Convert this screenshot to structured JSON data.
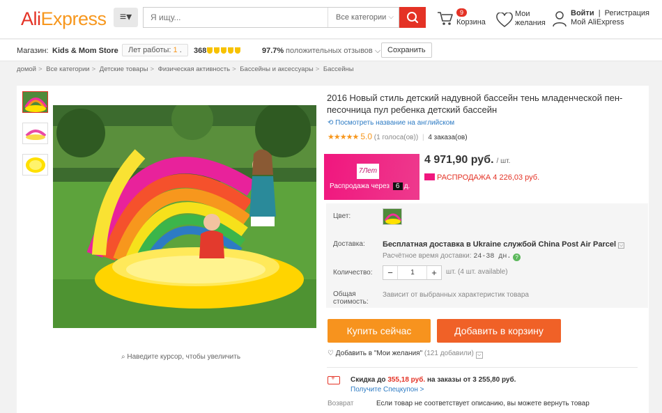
{
  "header": {
    "logo_part1": "Ali",
    "logo_part2": "Express",
    "search_placeholder": "Я ищу...",
    "category_select": "Все категории",
    "cart_count": "9",
    "cart_label": "Корзина",
    "wishlist_line1": "Мои",
    "wishlist_line2": "желания",
    "login": "Войти",
    "register": "Регистрация",
    "my_account": "Мой AliExpress"
  },
  "store": {
    "label": "Магазин:",
    "name": "Kids & Mom Store",
    "years_label": "Лет работы:",
    "years_value": "1",
    "score": "368",
    "positive_percent": "97.7%",
    "positive_label": "положительных отзывов",
    "save_label": "Сохранить"
  },
  "breadcrumbs": [
    "домой",
    "Все категории",
    "Детские товары",
    "Физическая активность",
    "Бассейны и аксессуары",
    "Бассейны"
  ],
  "gallery": {
    "zoom_hint": "Наведите курсор, чтобы увеличить"
  },
  "product": {
    "title": "2016 Новый стиль детский надувной бассейн тень младенческой пен-песочница пул ребенка детский бассейн",
    "translate_link": "Посмотреть название на английском",
    "rating": 5.0,
    "rating_text": "5.0",
    "votes": "(1 голоса(ов))",
    "orders": "4 заказа(ов)",
    "sale_logo": "7Лет",
    "sale_countdown_label": "Распродажа через",
    "sale_countdown_days": "6",
    "sale_countdown_unit": "д.",
    "price": "4 971,90 руб.",
    "price_unit": "/ шт.",
    "sale_price": "РАСПРОДАЖА 4 226,03 руб.",
    "color_label": "Цвет:",
    "delivery_label": "Доставка:",
    "delivery_text": "Бесплатная доставка в Ukraine службой China Post Air Parcel",
    "delivery_time_label": "Расчётное время доставки:",
    "delivery_time_value": "24-38 дн.",
    "qty_label": "Количество:",
    "qty_value": "1",
    "stock": "шт. (4 шт. available)",
    "total_label_line1": "Общая",
    "total_label_line2": "стоимость:",
    "total_value": "Зависит от выбранных характеристик товара",
    "buy_now": "Купить сейчас",
    "add_to_cart": "Добавить в корзину",
    "wishlist_add": "Добавить в \"Мои желания\"",
    "wishlist_count": "(121 добавили)",
    "discount_prefix": "Скидка до",
    "discount_amount": "355,18 руб.",
    "discount_suffix": "на заказы от 3 255,80 руб.",
    "coupon_link": "Получите Спецкупон >",
    "returns_label": "Возврат",
    "returns_text": "Если товар не соответствует описанию, вы можете вернуть товар"
  },
  "colors": {
    "accent": "#e43225",
    "orange": "#f7971d",
    "buy_button": "#f7931e",
    "cart_button": "#f06127",
    "sale_pink": "#f0167e",
    "link": "#2d7bc4"
  }
}
